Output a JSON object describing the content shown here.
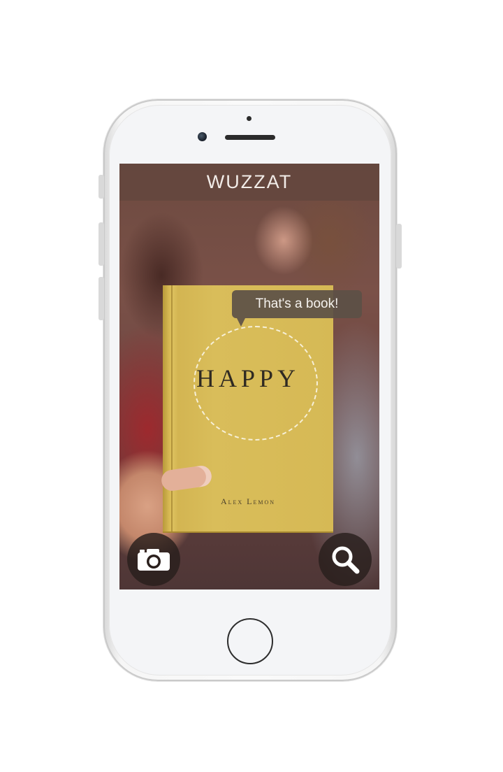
{
  "app": {
    "title": "WUZZAT"
  },
  "tooltip": {
    "text": "That's a book!"
  },
  "book": {
    "title": "HAPPY",
    "author": "Alex Lemon"
  },
  "actions": {
    "camera_icon": "camera-icon",
    "search_icon": "magnifier-icon"
  },
  "colors": {
    "topbar": "#64463e",
    "book": "#d6b955",
    "tooltip": "#5c5046"
  }
}
